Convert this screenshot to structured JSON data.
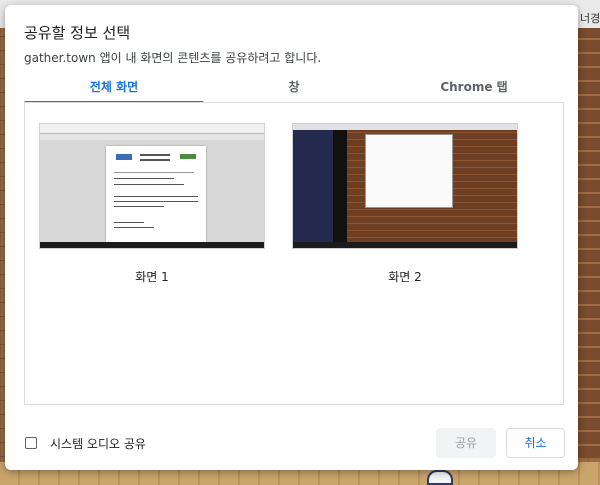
{
  "background": {
    "top_left_text": "",
    "top_right_text": "너경"
  },
  "dialog": {
    "title": "공유할 정보 선택",
    "subtitle": "gather.town 앱이 내 화면의 콘텐츠를 공유하려고 합니다.",
    "tabs": [
      {
        "label": "전체 화면",
        "active": true
      },
      {
        "label": "창",
        "active": false
      },
      {
        "label": "Chrome 탭",
        "active": false
      }
    ],
    "screens": [
      {
        "label": "화면 1",
        "icon": "document-screen-thumbnail"
      },
      {
        "label": "화면 2",
        "icon": "game-screen-thumbnail"
      }
    ],
    "system_audio": {
      "label": "시스템 오디오 공유",
      "checked": false
    },
    "buttons": {
      "share": "공유",
      "cancel": "취소"
    }
  },
  "colors": {
    "accent": "#1a73e8",
    "disabled_text": "#9aa0a6"
  }
}
